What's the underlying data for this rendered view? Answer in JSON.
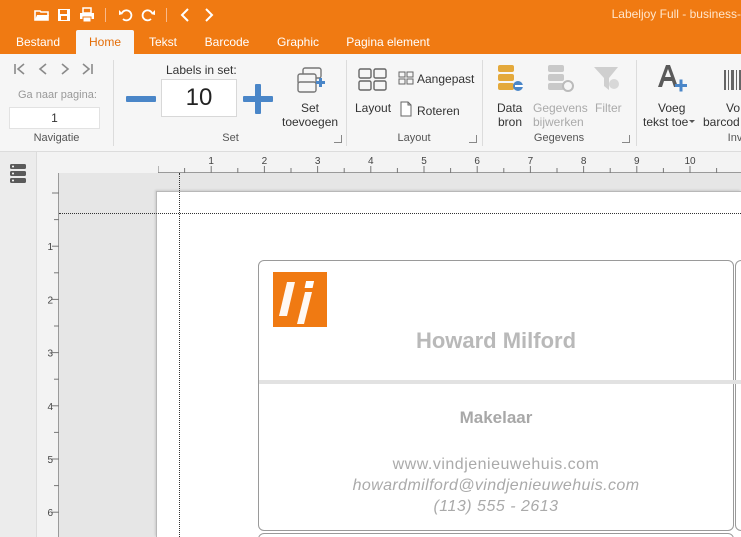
{
  "window": {
    "title": "Labeljoy Full - business-"
  },
  "tabs": [
    {
      "label": "Bestand"
    },
    {
      "label": "Home"
    },
    {
      "label": "Tekst"
    },
    {
      "label": "Barcode"
    },
    {
      "label": "Graphic"
    },
    {
      "label": "Pagina element"
    }
  ],
  "ribbon": {
    "navigation": {
      "goto_label": "Ga naar pagina:",
      "page_value": "1",
      "group_label": "Navigatie"
    },
    "set": {
      "labels_in_set_label": "Labels in set:",
      "labels_in_set_value": "10",
      "add_set_label_1": "Set",
      "add_set_label_2": "toevoegen",
      "group_label": "Set"
    },
    "layout": {
      "layout_label": "Layout",
      "custom_label": "Aangepast",
      "rotate_label": "Roteren",
      "group_label": "Layout"
    },
    "data": {
      "datasource_label_1": "Data",
      "datasource_label_2": "bron",
      "update_label_1": "Gegevens",
      "update_label_2": "bijwerken",
      "filter_label": "Filter",
      "group_label": "Gegevens"
    },
    "insert": {
      "add_text_label_1": "Voeg",
      "add_text_label_2": "tekst toe",
      "add_barcode_label_1": "Vo",
      "add_barcode_label_2": "barcod",
      "group_label": "Inv"
    }
  },
  "ruler": {
    "top_numbers": [
      "1",
      "2",
      "3",
      "4",
      "5",
      "6",
      "7",
      "8",
      "9",
      "10"
    ],
    "left_numbers": [
      "1",
      "2",
      "3",
      "4",
      "5",
      "6"
    ]
  },
  "label": {
    "name": "Howard Milford",
    "role": "Makelaar",
    "website": "www.vindjenieuwehuis.com",
    "email": "howardmilford@vindjenieuwehuis.com",
    "phone": "(113) 555 - 2613",
    "logo_color": "#f07a12"
  },
  "colors": {
    "accent": "#f07a12",
    "button_blue": "#4a86c8"
  }
}
